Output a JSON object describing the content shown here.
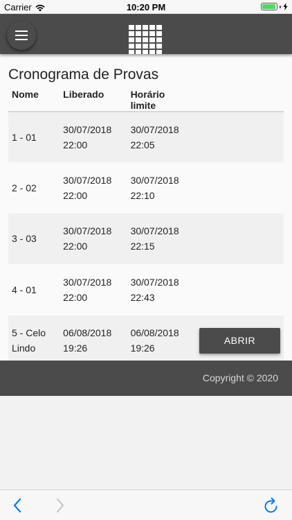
{
  "status_bar": {
    "carrier": "Carrier",
    "time": "10:20 PM",
    "battery_level": 0.95
  },
  "header": {
    "menu_icon": "hamburger-icon",
    "logo_icon": "grid-logo-icon"
  },
  "page": {
    "title": "Cronograma de Provas"
  },
  "table": {
    "columns": [
      "Nome",
      "Liberado",
      "Horário limite"
    ],
    "rows": [
      {
        "name": "1 - 01",
        "released": [
          "30/07/2018",
          "22:00"
        ],
        "deadline": [
          "30/07/2018",
          "22:05"
        ],
        "action": ""
      },
      {
        "name": "2 - 02",
        "released": [
          "30/07/2018",
          "22:00"
        ],
        "deadline": [
          "30/07/2018",
          "22:10"
        ],
        "action": ""
      },
      {
        "name": "3 - 03",
        "released": [
          "30/07/2018",
          "22:00"
        ],
        "deadline": [
          "30/07/2018",
          "22:15"
        ],
        "action": ""
      },
      {
        "name": "4 - 01",
        "released": [
          "30/07/2018",
          "22:00"
        ],
        "deadline": [
          "30/07/2018",
          "22:43"
        ],
        "action": ""
      },
      {
        "name": [
          "5 - Celo",
          "Lindo"
        ],
        "released": [
          "06/08/2018",
          "19:26"
        ],
        "deadline": [
          "06/08/2018",
          "19:26"
        ],
        "action": "ABRIR"
      }
    ]
  },
  "footer": {
    "copyright": "Copyright © 2020"
  },
  "toolbar": {
    "back_icon": "chevron-left-icon",
    "forward_icon": "chevron-right-icon",
    "reload_icon": "reload-icon"
  },
  "colors": {
    "header_bg": "#4a4b4a",
    "accent_blue": "#007aff",
    "battery_green": "#4cd964"
  }
}
